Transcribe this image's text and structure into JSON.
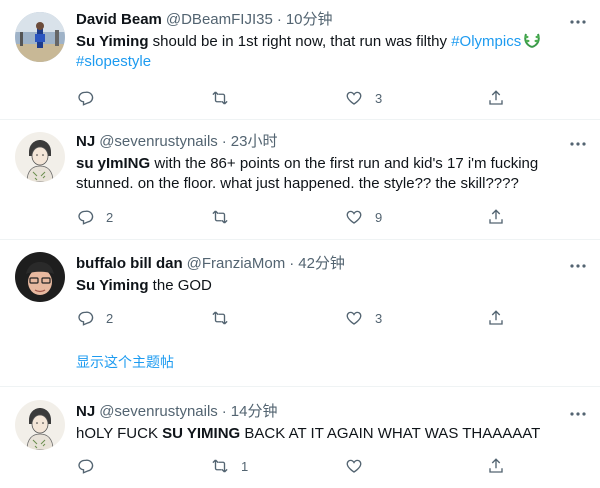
{
  "tweets": [
    {
      "name": "David Beam",
      "handle": "@DBeamFIJI35",
      "time": "10分钟",
      "text": {
        "bold": "Su Yiming",
        "rest": " should be in 1st right now, that run was filthy ",
        "hashtag1": "#Olympics",
        "hashtag2": "#slopestyle"
      },
      "reply_count": "",
      "retweet_count": "",
      "like_count": "3"
    },
    {
      "name": "NJ",
      "handle": "@sevenrustynails",
      "time": "23小时",
      "text": {
        "bold": "su yImING",
        "rest": " with the 86+ points on the first run and kid's 17 i'm fucking stunned. on the floor. what just happened. the style?? the skill????"
      },
      "reply_count": "2",
      "retweet_count": "",
      "like_count": "9"
    },
    {
      "name": "buffalo bill dan",
      "handle": "@FranziaMom",
      "time": "42分钟",
      "text": {
        "bold": "Su Yiming",
        "rest": " the GOD"
      },
      "reply_count": "2",
      "retweet_count": "",
      "like_count": "3"
    },
    {
      "name": "NJ",
      "handle": "@sevenrustynails",
      "time": "14分钟",
      "text": {
        "pre": "hOLY FUCK ",
        "bold": "SU YIMING",
        "rest": " BACK AT IT AGAIN WHAT WAS THAAAAAT"
      },
      "reply_count": "",
      "retweet_count": "1",
      "like_count": ""
    }
  ],
  "show_thread": "显示这个主题帖",
  "icons": {
    "reply": "reply-icon",
    "retweet": "retweet-icon",
    "like": "heart-icon",
    "share": "share-icon",
    "more": "more-icon",
    "laurel": "laurel-emoji-icon"
  },
  "colors": {
    "text": "#0f1419",
    "secondary": "#536471",
    "link": "#1d9bf0",
    "divider": "#eff3f4"
  }
}
